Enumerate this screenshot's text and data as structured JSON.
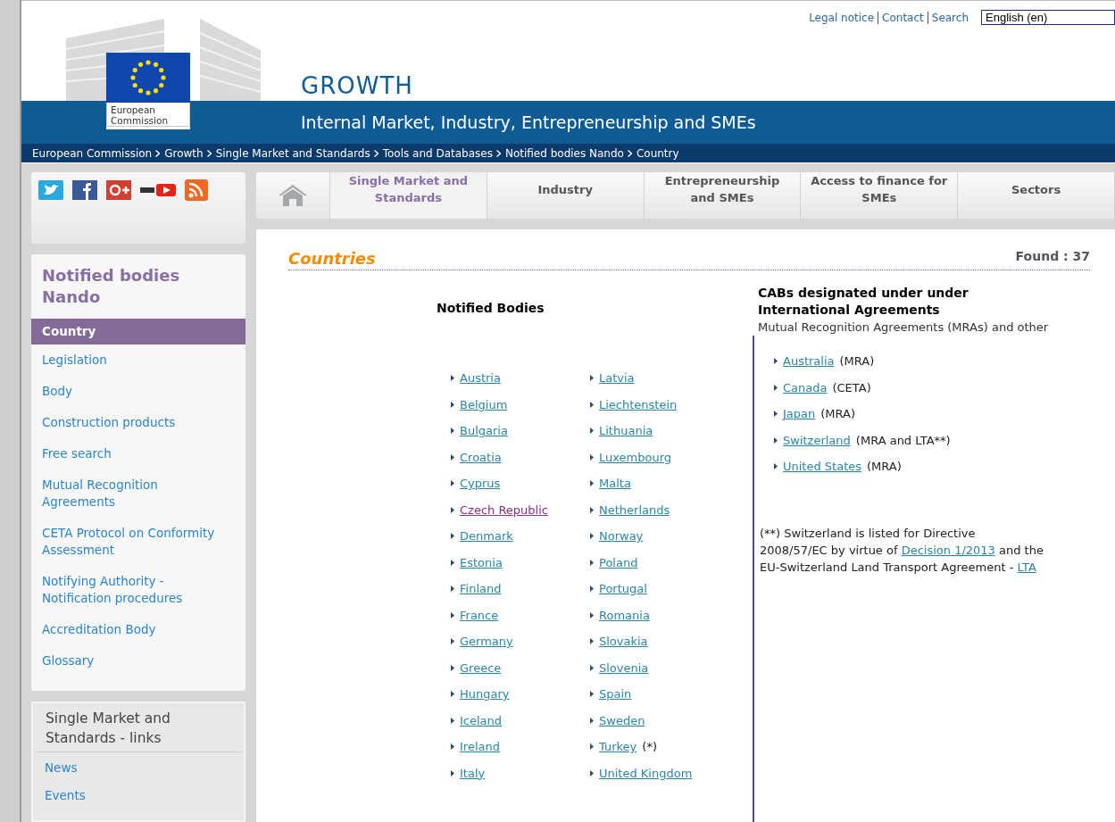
{
  "top_links": [
    "Legal notice",
    "Contact",
    "Search"
  ],
  "language": {
    "value": "English (en)"
  },
  "logo": {
    "caption": "European Commission"
  },
  "site": {
    "title": "GROWTH",
    "subtitle": "Internal Market, Industry, Entrepreneurship and SMEs"
  },
  "breadcrumb": [
    "European Commission",
    "Growth",
    "Single Market and Standards",
    "Tools and Databases",
    "Notified bodies Nando",
    "Country"
  ],
  "nav": [
    {
      "label": "Single Market and Standards",
      "selected": true
    },
    {
      "label": "Industry",
      "selected": false
    },
    {
      "label": "Entrepreneurship and SMEs",
      "selected": false
    },
    {
      "label": "Access to finance for SMEs",
      "selected": false
    },
    {
      "label": "Sectors",
      "selected": false
    }
  ],
  "sidebar": {
    "title": "Notified bodies Nando",
    "items": [
      {
        "label": "Country",
        "selected": true
      },
      {
        "label": "Legislation",
        "selected": false
      },
      {
        "label": "Body",
        "selected": false
      },
      {
        "label": "Construction products",
        "selected": false
      },
      {
        "label": "Free search",
        "selected": false
      },
      {
        "label": "Mutual Recognition Agreements",
        "selected": false
      },
      {
        "label": "CETA Protocol on Conformity Assessment",
        "selected": false
      },
      {
        "label": "Notifying Authority - Notification procedures",
        "selected": false
      },
      {
        "label": "Accreditation Body",
        "selected": false
      },
      {
        "label": "Glossary",
        "selected": false
      }
    ]
  },
  "links_box": {
    "title": "Single Market and Standards - links",
    "items": [
      "News",
      "Events"
    ]
  },
  "main": {
    "title": "Countries",
    "found": "Found : 37",
    "notified": {
      "heading": "Notified Bodies",
      "columns": [
        [
          {
            "name": "Austria",
            "visited": false
          },
          {
            "name": "Belgium",
            "visited": false
          },
          {
            "name": "Bulgaria",
            "visited": false
          },
          {
            "name": "Croatia",
            "visited": false
          },
          {
            "name": "Cyprus",
            "visited": false
          },
          {
            "name": "Czech Republic",
            "visited": true
          },
          {
            "name": "Denmark",
            "visited": false
          },
          {
            "name": "Estonia",
            "visited": false
          },
          {
            "name": "Finland",
            "visited": false
          },
          {
            "name": "France",
            "visited": false
          },
          {
            "name": "Germany",
            "visited": false
          },
          {
            "name": "Greece",
            "visited": false
          },
          {
            "name": "Hungary",
            "visited": false
          },
          {
            "name": "Iceland",
            "visited": false
          },
          {
            "name": "Ireland",
            "visited": false
          },
          {
            "name": "Italy",
            "visited": false
          }
        ],
        [
          {
            "name": "Latvia",
            "visited": false
          },
          {
            "name": "Liechtenstein",
            "visited": false
          },
          {
            "name": "Lithuania",
            "visited": false
          },
          {
            "name": "Luxembourg",
            "visited": false
          },
          {
            "name": "Malta",
            "visited": false
          },
          {
            "name": "Netherlands",
            "visited": false
          },
          {
            "name": "Norway",
            "visited": false
          },
          {
            "name": "Poland",
            "visited": false
          },
          {
            "name": "Portugal",
            "visited": false
          },
          {
            "name": "Romania",
            "visited": false
          },
          {
            "name": "Slovakia",
            "visited": false
          },
          {
            "name": "Slovenia",
            "visited": false
          },
          {
            "name": "Spain",
            "visited": false
          },
          {
            "name": "Sweden",
            "visited": false
          },
          {
            "name": "Turkey",
            "visited": false,
            "note": "(*)"
          },
          {
            "name": "United Kingdom",
            "visited": false
          }
        ]
      ]
    },
    "cabs": {
      "heading": "CABs designated under under International Agreements",
      "subheading": "Mutual Recognition Agreements (MRAs) and other",
      "items": [
        {
          "name": "Australia",
          "note": "(MRA)"
        },
        {
          "name": "Canada",
          "note": "(CETA)"
        },
        {
          "name": "Japan",
          "note": "(MRA)"
        },
        {
          "name": "Switzerland",
          "note": "(MRA and LTA**)"
        },
        {
          "name": "United States",
          "note": "(MRA)"
        }
      ],
      "footnote": [
        {
          "kind": "text",
          "text": "(**) Switzerland is listed for Directive 2008/57/EC by virtue of "
        },
        {
          "kind": "link",
          "text": "Decision 1/2013"
        },
        {
          "kind": "text",
          "text": " and the EU-Switzerland Land Transport Agreement - "
        },
        {
          "kind": "link",
          "text": "LTA"
        }
      ]
    }
  }
}
